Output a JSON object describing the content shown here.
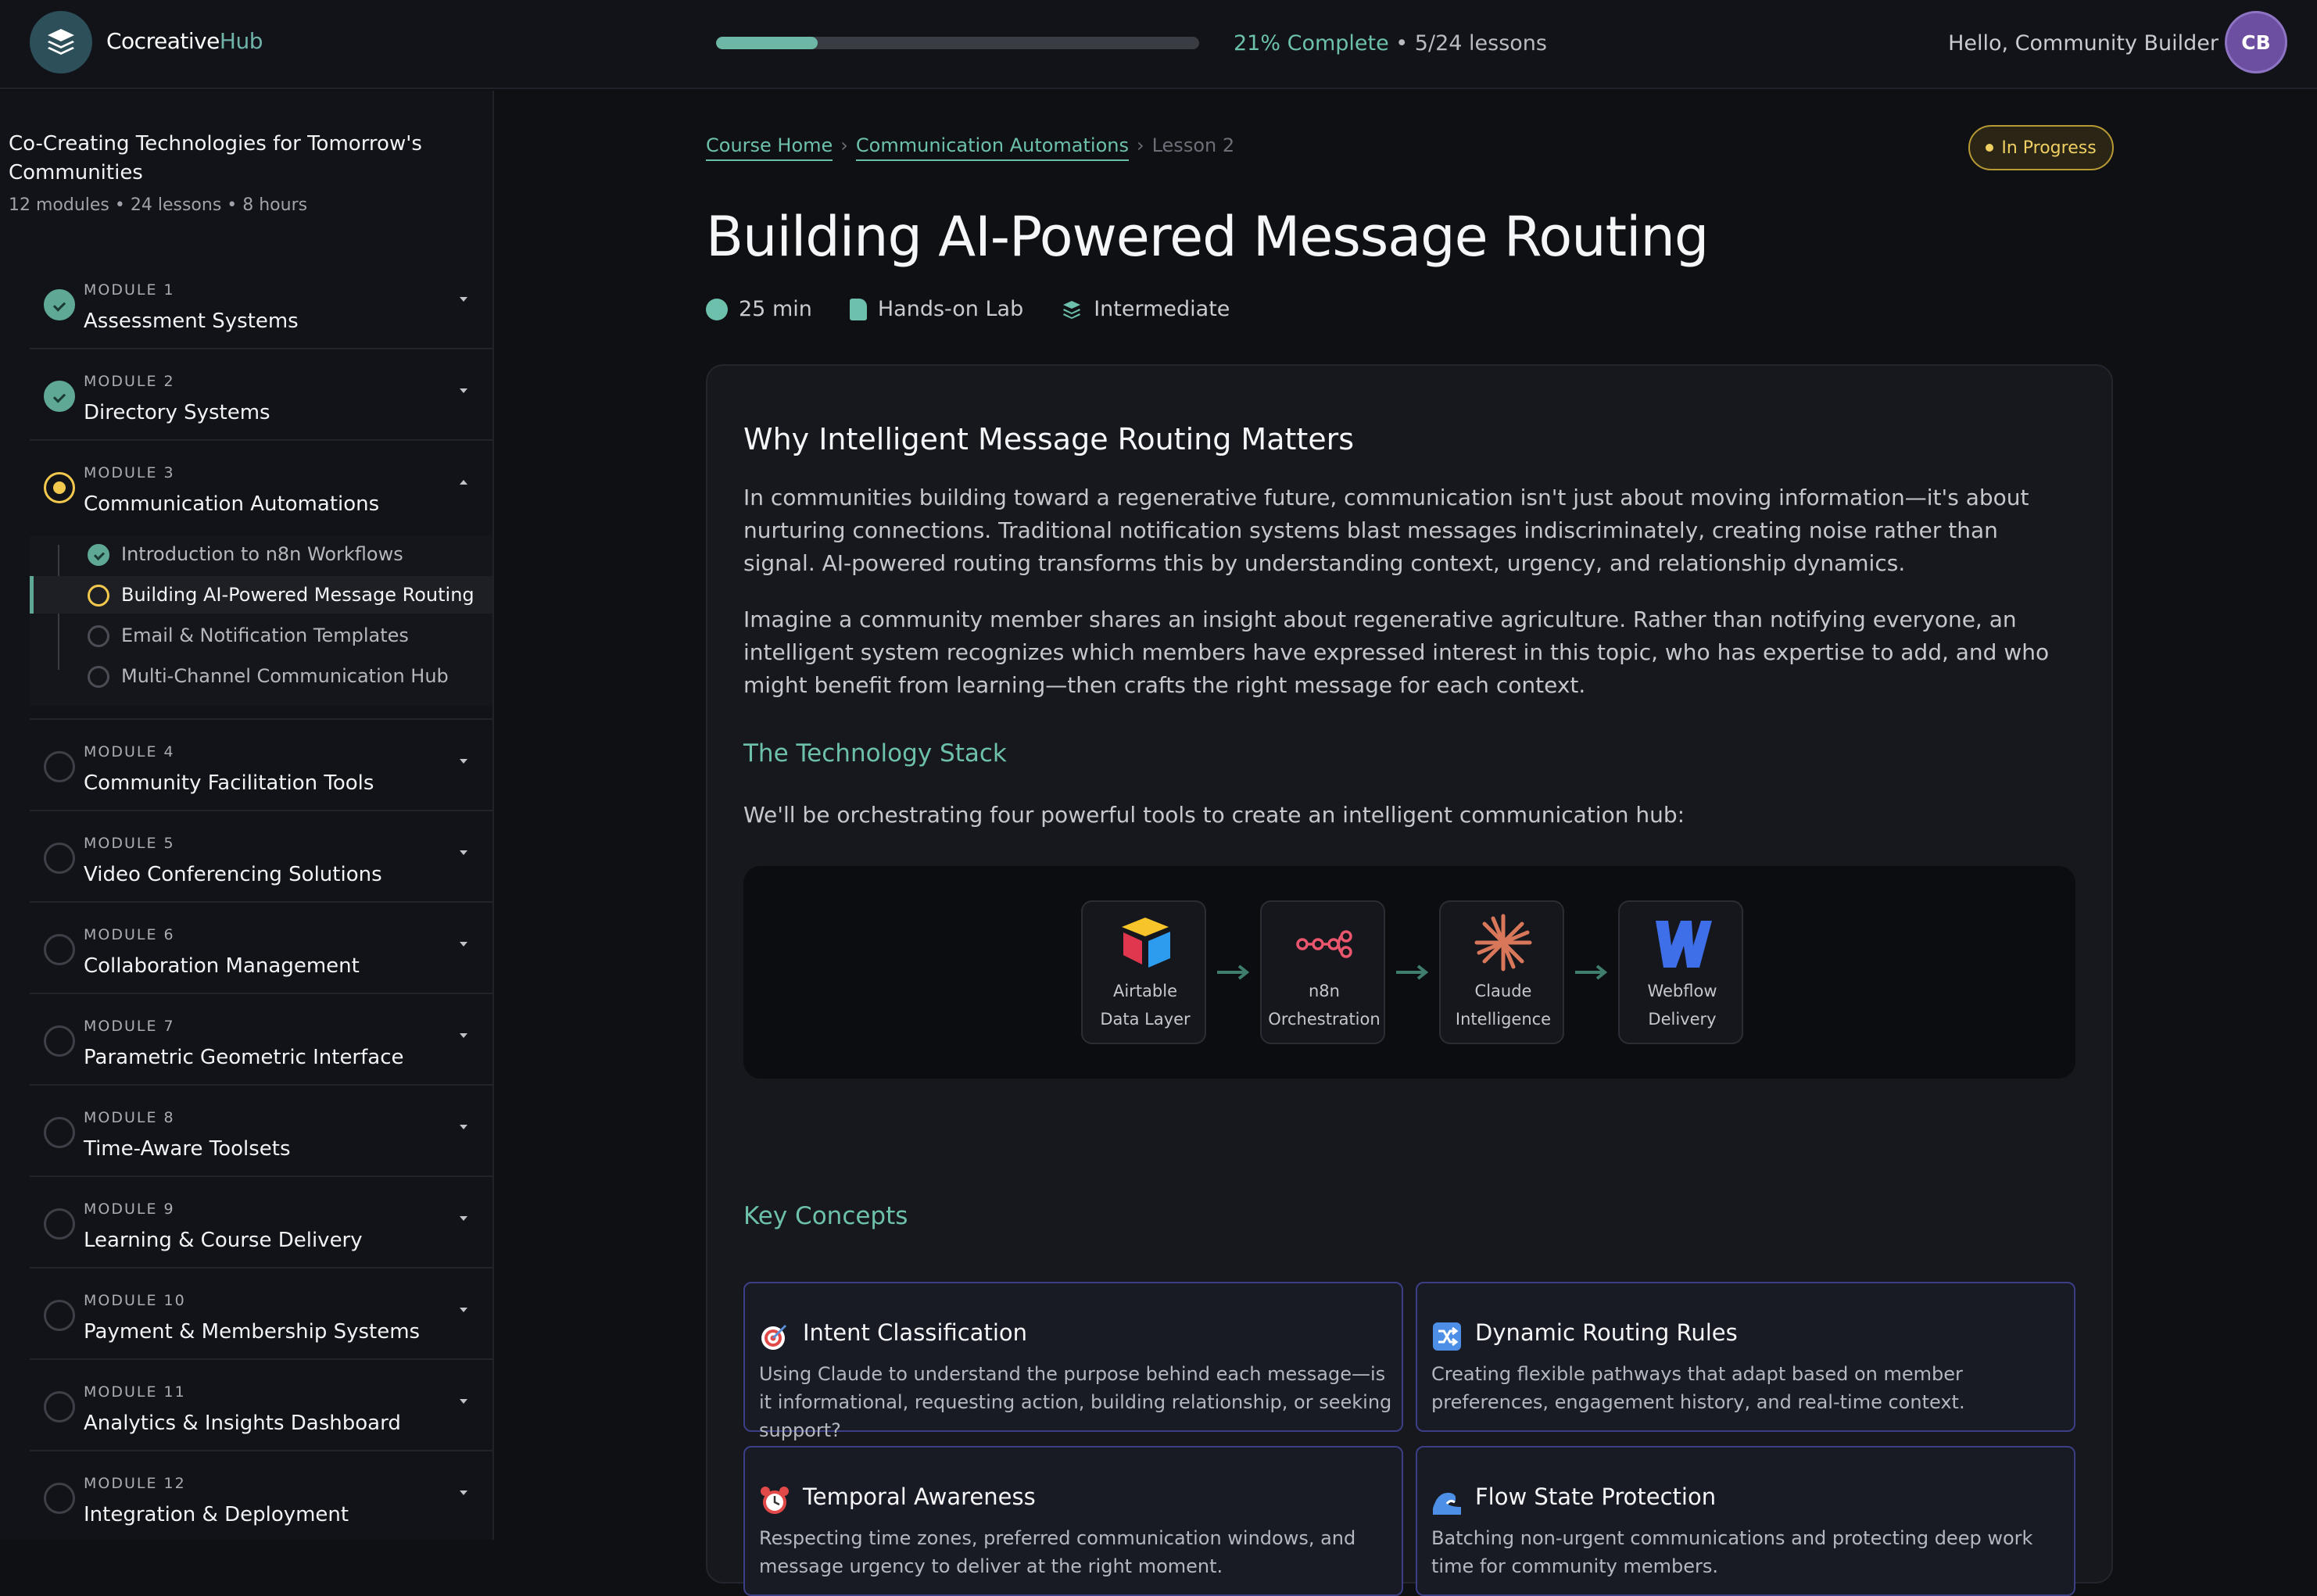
{
  "header": {
    "brand_part1": "Cocreative",
    "brand_part2": "Hub",
    "progress_percent": 21,
    "progress_label": "21% Complete",
    "progress_lessons": " • 5/24 lessons",
    "greeting": "Hello, Community Builder",
    "avatar_initials": "CB"
  },
  "sidebar": {
    "course_title": "Co-Creating Technologies for Tomorrow's Communities",
    "course_meta": "12 modules • 24 lessons • 8 hours",
    "modules": [
      {
        "number": "MODULE 1",
        "title": "Assessment Systems",
        "status": "done"
      },
      {
        "number": "MODULE 2",
        "title": "Directory Systems",
        "status": "done"
      },
      {
        "number": "MODULE 3",
        "title": "Communication Automations",
        "status": "in-progress"
      },
      {
        "number": "MODULE 4",
        "title": "Community Facilitation Tools",
        "status": "not-started"
      },
      {
        "number": "MODULE 5",
        "title": "Video Conferencing Solutions",
        "status": "not-started"
      },
      {
        "number": "MODULE 6",
        "title": "Collaboration Management",
        "status": "not-started"
      },
      {
        "number": "MODULE 7",
        "title": "Parametric Geometric Interface",
        "status": "not-started"
      },
      {
        "number": "MODULE 8",
        "title": "Time-Aware Toolsets",
        "status": "not-started"
      },
      {
        "number": "MODULE 9",
        "title": "Learning & Course Delivery",
        "status": "not-started"
      },
      {
        "number": "MODULE 10",
        "title": "Payment & Membership Systems",
        "status": "not-started"
      },
      {
        "number": "MODULE 11",
        "title": "Analytics & Insights Dashboard",
        "status": "not-started"
      },
      {
        "number": "MODULE 12",
        "title": "Integration & Deployment",
        "status": "not-started"
      }
    ],
    "module3_lessons": [
      {
        "title": "Introduction to n8n Workflows",
        "status": "done"
      },
      {
        "title": "Building AI-Powered Message Routing",
        "status": "current"
      },
      {
        "title": "Email & Notification Templates",
        "status": "not-started"
      },
      {
        "title": "Multi-Channel Communication Hub",
        "status": "not-started"
      }
    ]
  },
  "breadcrumb": {
    "home": "Course Home",
    "module": "Communication Automations",
    "current": "Lesson 2",
    "separator": "›"
  },
  "status_badge": "In Progress",
  "lesson": {
    "title": "Building AI-Powered Message Routing",
    "duration": "25 min",
    "format": "Hands-on Lab",
    "level": "Intermediate"
  },
  "content": {
    "heading": "Why Intelligent Message Routing Matters",
    "paragraph1": "In communities building toward a regenerative future, communication isn't just about moving information—it's about nurturing connections. Traditional notification systems blast messages indiscriminately, creating noise rather than signal. AI-powered routing transforms this by understanding context, urgency, and relationship dynamics.",
    "paragraph2": "Imagine a community member shares an insight about regenerative agriculture. Rather than notifying everyone, an intelligent system recognizes which members have expressed interest in this topic, who has expertise to add, and who might benefit from learning—then crafts the right message for each context.",
    "stack_heading": "The Technology Stack",
    "stack_intro": "We'll be orchestrating four powerful tools to create an intelligent communication hub:",
    "tools": [
      {
        "name": "Airtable",
        "role": "Data Layer",
        "icon": "airtable-icon"
      },
      {
        "name": "n8n",
        "role": "Orchestration",
        "icon": "n8n-icon"
      },
      {
        "name": "Claude",
        "role": "Intelligence",
        "icon": "claude-icon"
      },
      {
        "name": "Webflow",
        "role": "Delivery",
        "icon": "webflow-icon"
      }
    ],
    "concepts_heading": "Key Concepts",
    "concepts": [
      {
        "icon": "target-icon",
        "title": "Intent Classification",
        "desc": "Using Claude to understand the purpose behind each message—is it informational, requesting action, building relationship, or seeking support?"
      },
      {
        "icon": "shuffle-icon",
        "title": "Dynamic Routing Rules",
        "desc": "Creating flexible pathways that adapt based on member preferences, engagement history, and real-time context."
      },
      {
        "icon": "alarm-clock-icon",
        "title": "Temporal Awareness",
        "desc": "Respecting time zones, preferred communication windows, and message urgency to deliver at the right moment."
      },
      {
        "icon": "wave-icon",
        "title": "Flow State Protection",
        "desc": "Batching non-urgent communications and protecting deep work time for community members."
      }
    ]
  },
  "colors": {
    "accent": "#6cc0ac",
    "in_progress": "#f3c94d",
    "background": "#0f1014",
    "avatar": "#6c4fa0"
  }
}
